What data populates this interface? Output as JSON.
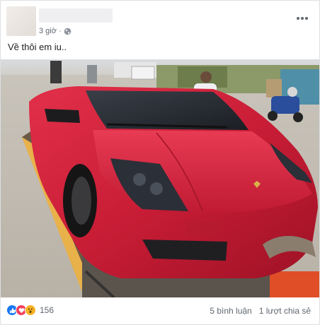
{
  "post": {
    "author": "",
    "time": "3 giờ",
    "separator": "·",
    "privacy_icon": "globe-icon",
    "options_icon": "more-options-icon",
    "caption": "Về thôi em iu..",
    "photo_alt": "red-supercar-on-tow-truck"
  },
  "footer": {
    "reaction_icons": [
      "like-icon",
      "love-icon",
      "wow-icon"
    ],
    "reaction_count": "156",
    "comments": "5 bình luận",
    "shares": "1 lượt chia sẻ"
  },
  "colors": {
    "like": "#1877f2",
    "love": "#f33e58",
    "wow": "#f7b125",
    "meta_text": "#616770"
  }
}
